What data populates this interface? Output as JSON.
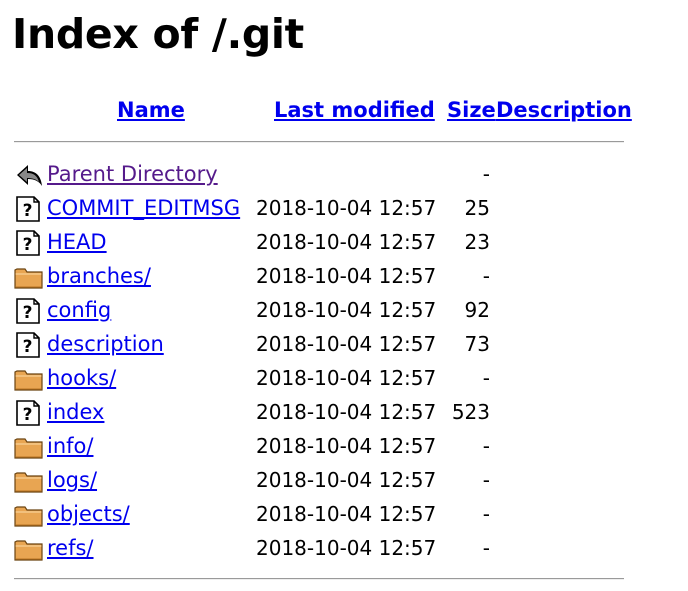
{
  "title": "Index of /.git",
  "columns": {
    "name": "Name",
    "last_modified": "Last modified",
    "size": "Size",
    "description": "Description"
  },
  "parent": {
    "label": "Parent Directory",
    "size": "-",
    "icon": "back-arrow-icon"
  },
  "entries": [
    {
      "name": "COMMIT_EDITMSG",
      "modified": "2018-10-04 12:57",
      "size": "25",
      "icon": "unknown-file-icon"
    },
    {
      "name": "HEAD",
      "modified": "2018-10-04 12:57",
      "size": "23",
      "icon": "unknown-file-icon"
    },
    {
      "name": "branches/",
      "modified": "2018-10-04 12:57",
      "size": "-",
      "icon": "folder-icon"
    },
    {
      "name": "config",
      "modified": "2018-10-04 12:57",
      "size": "92",
      "icon": "unknown-file-icon"
    },
    {
      "name": "description",
      "modified": "2018-10-04 12:57",
      "size": "73",
      "icon": "unknown-file-icon"
    },
    {
      "name": "hooks/",
      "modified": "2018-10-04 12:57",
      "size": "-",
      "icon": "folder-icon"
    },
    {
      "name": "index",
      "modified": "2018-10-04 12:57",
      "size": "523",
      "icon": "unknown-file-icon"
    },
    {
      "name": "info/",
      "modified": "2018-10-04 12:57",
      "size": "-",
      "icon": "folder-icon"
    },
    {
      "name": "logs/",
      "modified": "2018-10-04 12:57",
      "size": "-",
      "icon": "folder-icon"
    },
    {
      "name": "objects/",
      "modified": "2018-10-04 12:57",
      "size": "-",
      "icon": "folder-icon"
    },
    {
      "name": "refs/",
      "modified": "2018-10-04 12:57",
      "size": "-",
      "icon": "folder-icon"
    }
  ]
}
